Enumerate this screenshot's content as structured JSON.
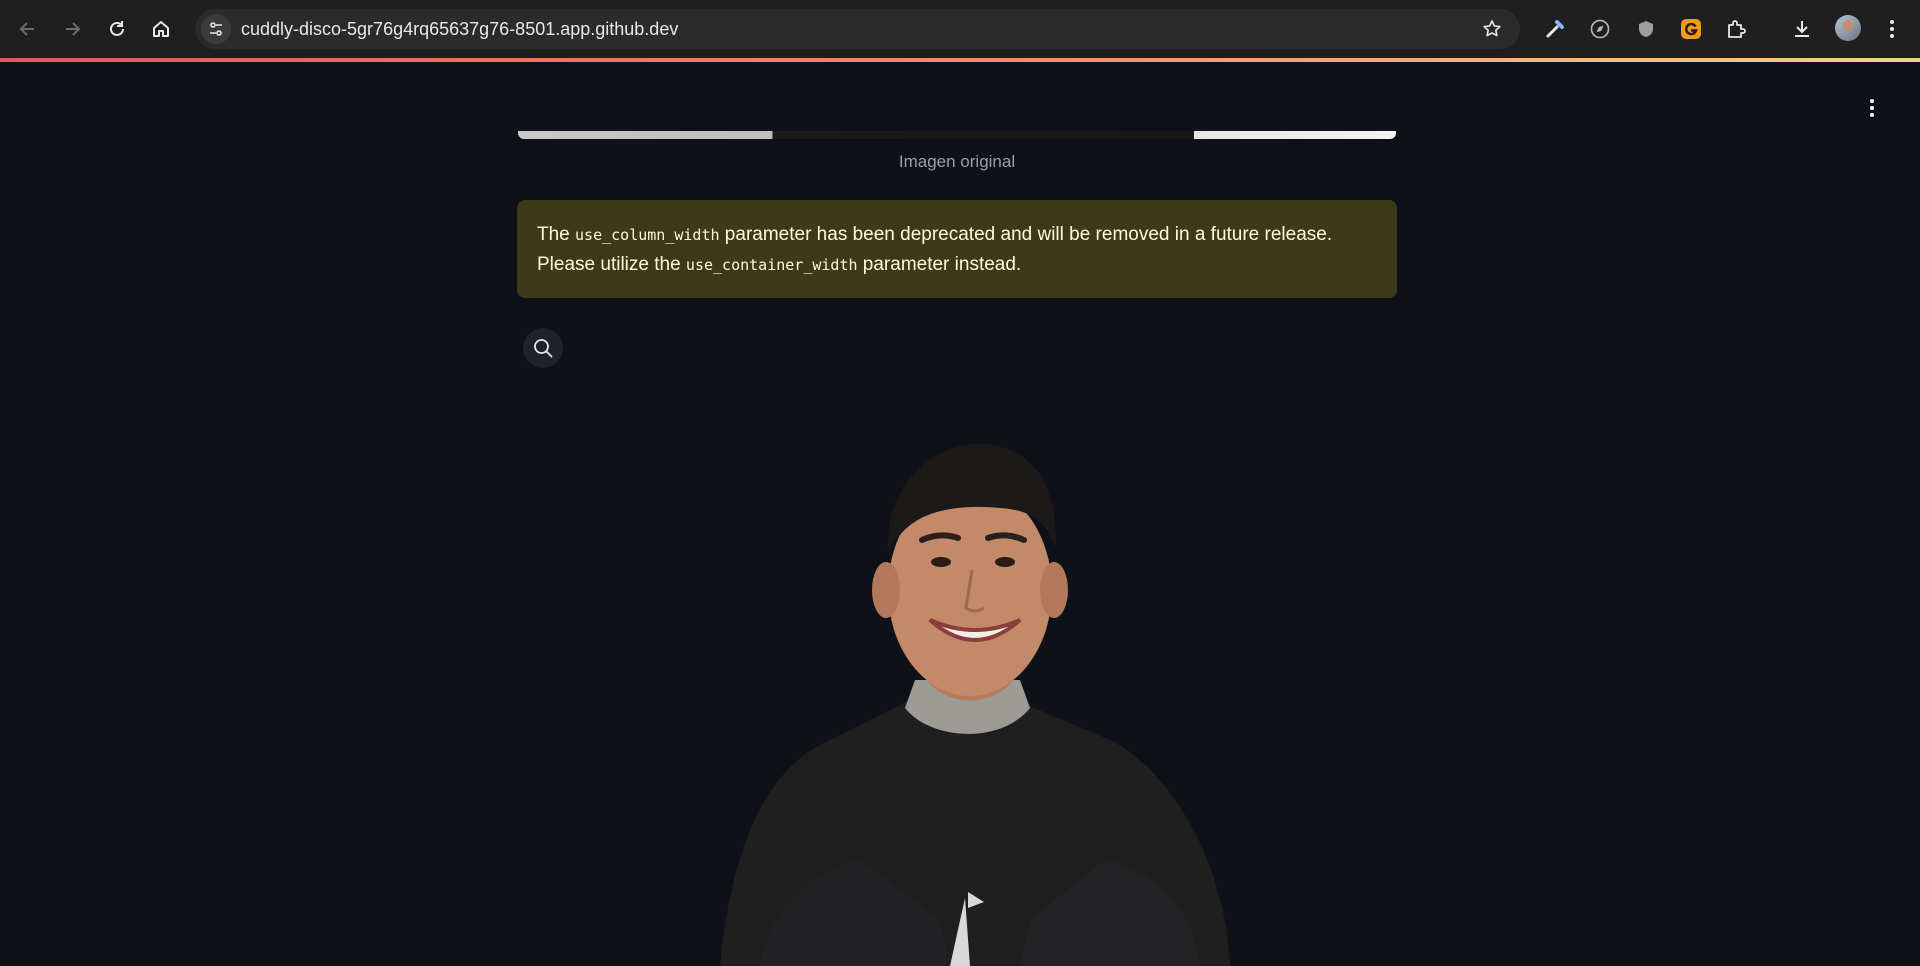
{
  "browser": {
    "url": "cuddly-disco-5gr76g4rq65637g76-8501.app.github.dev",
    "nav": {
      "back_icon": "arrow-left-icon",
      "forward_icon": "arrow-right-icon",
      "reload_icon": "reload-icon",
      "home_icon": "home-icon"
    },
    "toolbar_icons": [
      "eyedropper-icon",
      "compass-icon",
      "shield-icon",
      "grammarly-icon",
      "extensions-icon",
      "download-icon",
      "profile-avatar",
      "chrome-menu-icon"
    ]
  },
  "app": {
    "image_caption": "Imagen original",
    "warning": {
      "text_1": "The ",
      "code_1": "use_column_width",
      "text_2": " parameter has been deprecated and will be removed in a future release. Please utilize the ",
      "code_2": "use_container_width",
      "text_3": " parameter instead.",
      "bg_color": "#3d3a1a",
      "text_color": "#fffbd4"
    },
    "zoom_icon": "search-icon",
    "menu_icon": "kebab-menu-icon",
    "photo": "person-portrait-cutout"
  },
  "theme": {
    "background": "#0e1117",
    "chrome_bg": "#1f1f1f",
    "accent_gradient": [
      "#e0565c",
      "#f5d08c"
    ]
  }
}
